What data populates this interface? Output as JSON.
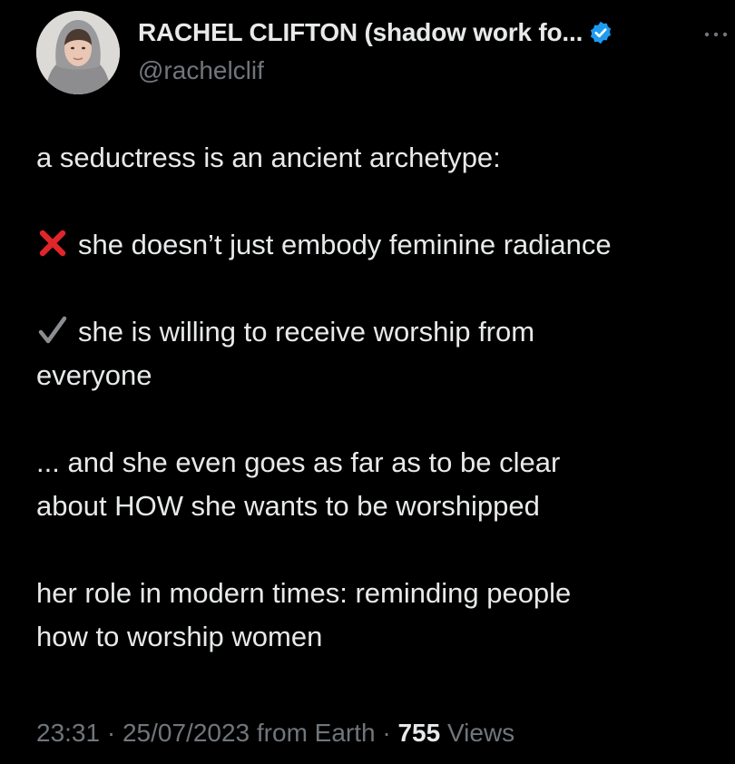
{
  "author": {
    "display_name": "RACHEL CLIFTON (shadow work fo...",
    "handle": "@rachelclif",
    "verified": true
  },
  "tweet": {
    "line1": "a seductress is an ancient archetype:",
    "line2_text": "she doesn’t just embody feminine radiance",
    "line2_icon": "cross-mark-icon",
    "line3_text": "she is willing to receive worship from",
    "line3_icon": "check-mark-icon",
    "line3_cont": "everyone",
    "line4a": "... and she even goes as far as to be clear",
    "line4b": "about HOW she wants to be worshipped",
    "line5a": "her role in modern times: reminding people",
    "line5b": "how to worship women"
  },
  "meta": {
    "time": "23:31",
    "date": "25/07/2023",
    "source": "from Earth",
    "views_count": "755",
    "views_label": "Views",
    "separator": "·"
  },
  "colors": {
    "background": "#000000",
    "text": "#e7e9ea",
    "secondary": "#71767b",
    "verified": "#1d9bf0",
    "cross": "#e0252b"
  }
}
